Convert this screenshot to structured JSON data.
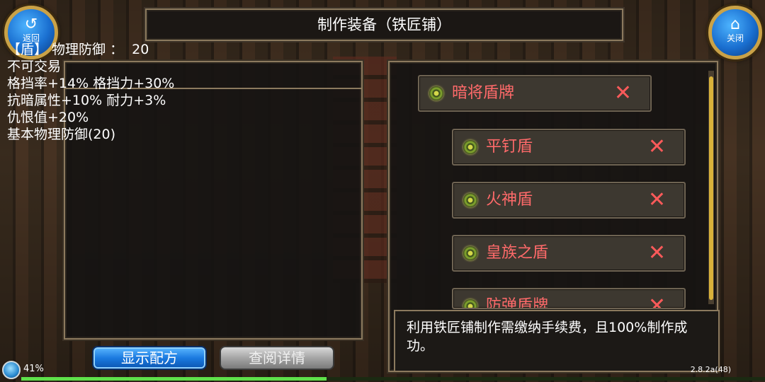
{
  "header": {
    "back_icon": "↺",
    "back_label": "返回",
    "close_icon": "⌂",
    "close_label": "关闭",
    "title": "制作装备（铁匠铺）"
  },
  "item_info": {
    "lines": [
      "【盾】 物理防御 ：  20",
      "不可交易",
      "格挡率+14% 格挡力+30%",
      "抗暗属性+10% 耐力+3%",
      "仇恨值+20%",
      "基本物理防御(20)"
    ]
  },
  "recipe_list": {
    "items": [
      {
        "name": "暗将盾牌",
        "remove_icon": "✕"
      },
      {
        "name": "平钉盾",
        "remove_icon": "✕"
      },
      {
        "name": "火神盾",
        "remove_icon": "✕"
      },
      {
        "name": "皇族之盾",
        "remove_icon": "✕"
      },
      {
        "name": "防弹盾牌",
        "remove_icon": "✕"
      }
    ]
  },
  "description": "利用铁匠铺制作需缴纳手续费，且100%制作成功。",
  "buttons": {
    "show_recipe": "显示配方",
    "view_detail": "查阅详情"
  },
  "status": {
    "battery": "41%",
    "progress": 0.41,
    "version": "2.8.2a(48)"
  },
  "colors": {
    "item_name": "#ff6a6a",
    "accent_blue": "#1b7ae0",
    "frame": "#8c7a5e",
    "progress_fill": "#5ee04a"
  }
}
